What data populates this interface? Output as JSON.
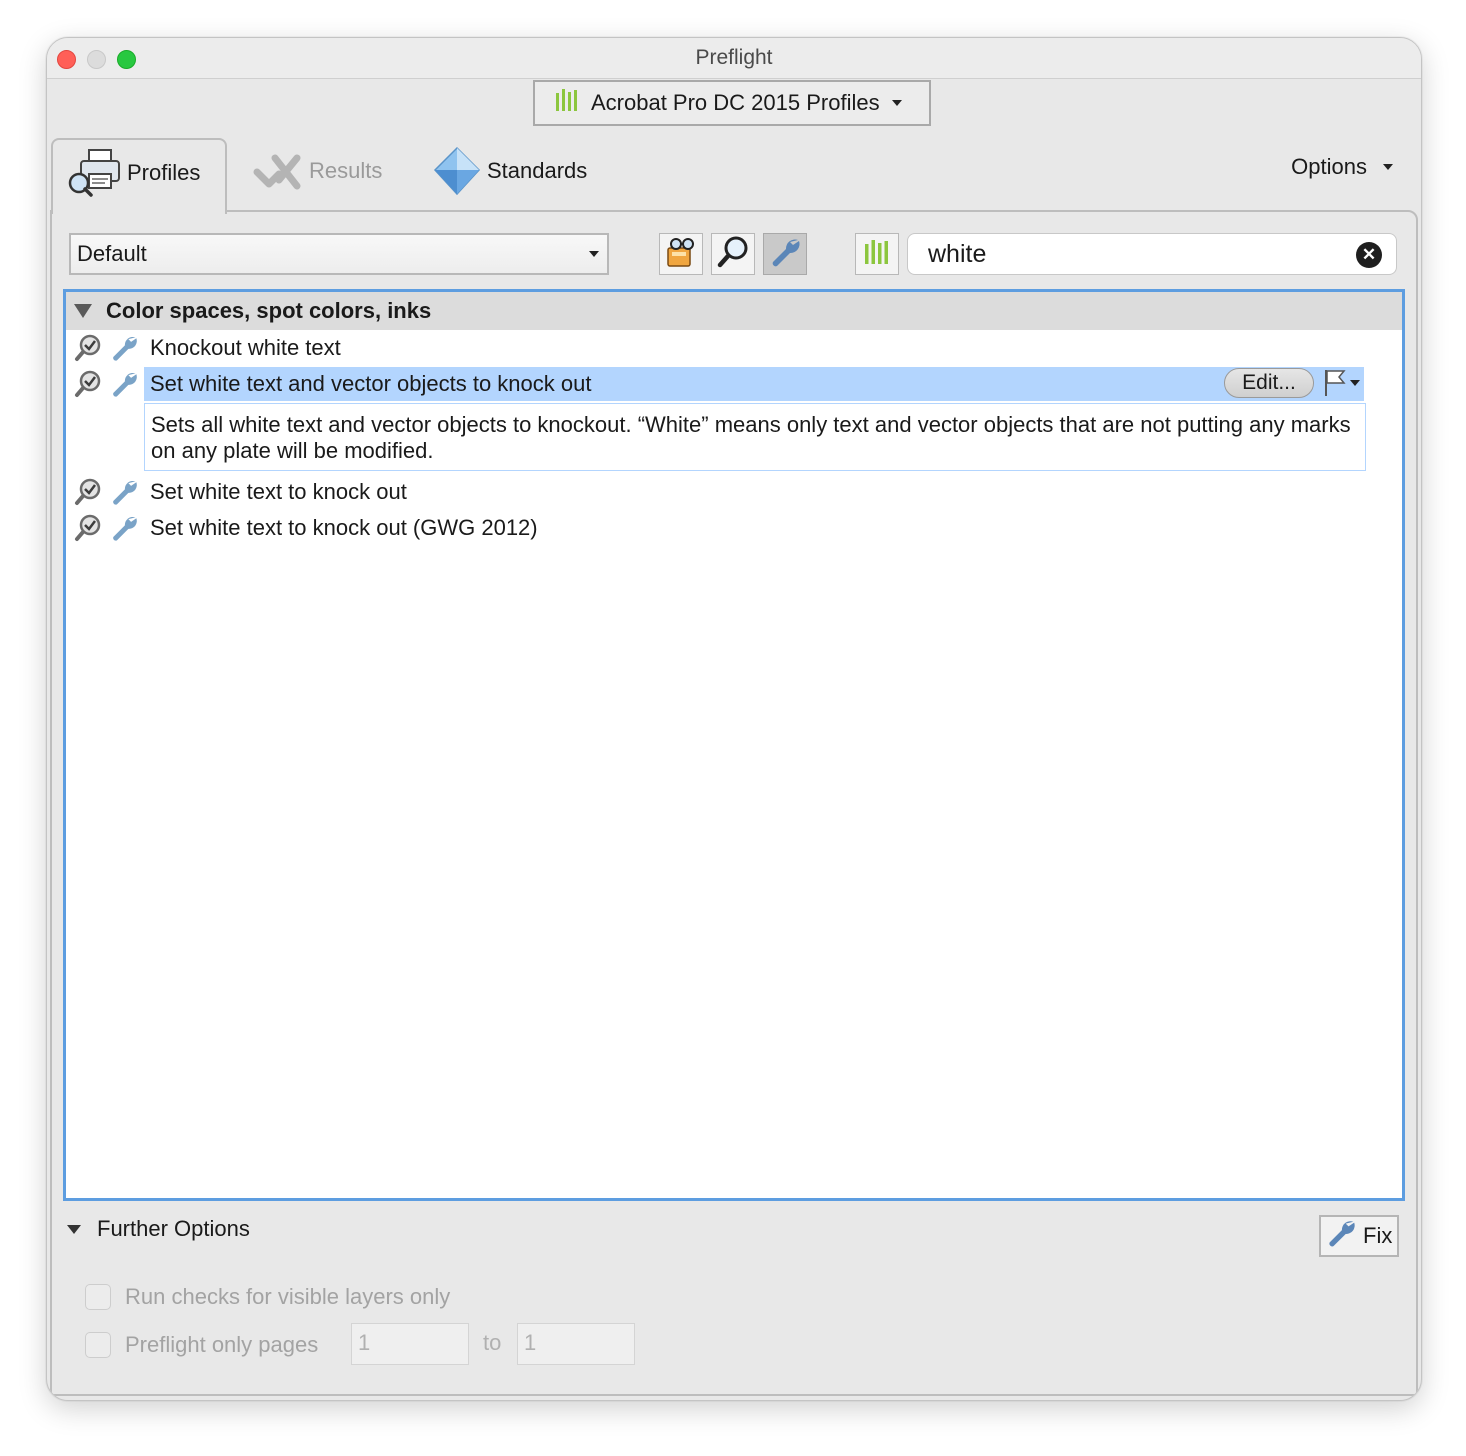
{
  "window": {
    "title": "Preflight"
  },
  "profile_library": {
    "selected": "Acrobat Pro DC 2015 Profiles",
    "icon": "library-bars-icon"
  },
  "tabs": [
    {
      "label": "Profiles",
      "icon": "printer-magnifier-icon",
      "active": true
    },
    {
      "label": "Results",
      "icon": "results-check-icon",
      "active": false
    },
    {
      "label": "Standards",
      "icon": "diamond-icon",
      "active": false
    }
  ],
  "options_label": "Options",
  "filter": {
    "selected": "Default"
  },
  "toolbar": {
    "buttons": [
      "profiles-filter-icon",
      "checks-filter-icon",
      "fixups-filter-icon",
      "library-filter-icon"
    ],
    "active": "fixups-filter-icon"
  },
  "search": {
    "value": "white"
  },
  "list": {
    "group_title": "Color spaces, spot colors, inks",
    "items": [
      {
        "label": "Knockout white text"
      },
      {
        "label": "Set white text and vector objects to knock out",
        "selected": true,
        "description": "Sets all white text and vector objects to knockout. “White” means only text and vector objects that are not putting any marks on any plate will be modified.",
        "edit_label": "Edit..."
      },
      {
        "label": "Set white text to knock out"
      },
      {
        "label": "Set white text to knock out (GWG 2012)"
      }
    ]
  },
  "further_options": {
    "label": "Further Options",
    "visible_layers_label": "Run checks for visible layers only",
    "pages_label": "Preflight only pages",
    "page_from": "1",
    "to_label": "to",
    "page_to": "1"
  },
  "fix_button": {
    "label": "Fix"
  },
  "colors": {
    "selection": "#b3d5fe",
    "list_border": "#5d9de0",
    "accent_green": "#8cc63e",
    "wrench_blue": "#5b86b8"
  }
}
